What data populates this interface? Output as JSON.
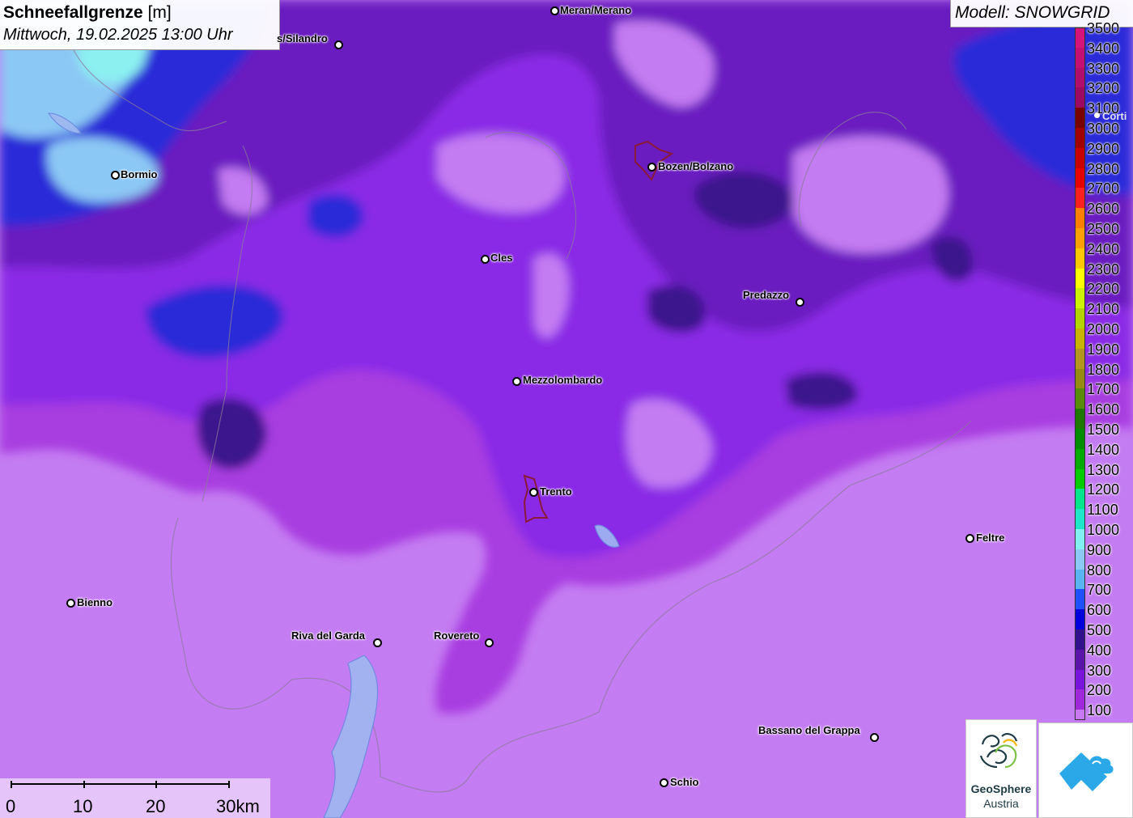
{
  "title": {
    "main": "Schneefallgrenze",
    "unit": "[m]",
    "datetime": "Mittwoch, 19.02.2025 13:00 Uhr"
  },
  "model": "Modell: SNOWGRID",
  "legend": {
    "items": [
      {
        "label": "3500",
        "color": "#d4147a"
      },
      {
        "label": "3400",
        "color": "#c41072"
      },
      {
        "label": "3300",
        "color": "#b10d6a"
      },
      {
        "label": "3200",
        "color": "#9c0a62"
      },
      {
        "label": "3100",
        "color": "#7a0000"
      },
      {
        "label": "3000",
        "color": "#a00000"
      },
      {
        "label": "2900",
        "color": "#c80000"
      },
      {
        "label": "2800",
        "color": "#e60000"
      },
      {
        "label": "2700",
        "color": "#ff2020"
      },
      {
        "label": "2600",
        "color": "#ff7f00"
      },
      {
        "label": "2500",
        "color": "#ffa000"
      },
      {
        "label": "2400",
        "color": "#ffc800"
      },
      {
        "label": "2300",
        "color": "#ffff00"
      },
      {
        "label": "2200",
        "color": "#ccf200"
      },
      {
        "label": "2100",
        "color": "#b4d400"
      },
      {
        "label": "2000",
        "color": "#c8b400"
      },
      {
        "label": "1900",
        "color": "#b4961e"
      },
      {
        "label": "1800",
        "color": "#968c14"
      },
      {
        "label": "1700",
        "color": "#5a8c0a"
      },
      {
        "label": "1600",
        "color": "#1e7800"
      },
      {
        "label": "1500",
        "color": "#008c00"
      },
      {
        "label": "1400",
        "color": "#00aa00"
      },
      {
        "label": "1300",
        "color": "#00cc00"
      },
      {
        "label": "1200",
        "color": "#00e68c"
      },
      {
        "label": "1100",
        "color": "#1ee6c8"
      },
      {
        "label": "1000",
        "color": "#82f0f0"
      },
      {
        "label": "900",
        "color": "#8cc8f5"
      },
      {
        "label": "800",
        "color": "#5ab4f0"
      },
      {
        "label": "700",
        "color": "#1e50ff"
      },
      {
        "label": "600",
        "color": "#0000dc"
      },
      {
        "label": "500",
        "color": "#32128c"
      },
      {
        "label": "400",
        "color": "#5a14a8"
      },
      {
        "label": "300",
        "color": "#7814dc"
      },
      {
        "label": "200",
        "color": "#a028dc"
      },
      {
        "label": "100",
        "color": "#c878f0"
      }
    ]
  },
  "cities": [
    {
      "name": "Meran/Merano"
    },
    {
      "name": "s/Silandro"
    },
    {
      "name": "Bormio"
    },
    {
      "name": "Bozen/Bolzano"
    },
    {
      "name": "Cles"
    },
    {
      "name": "Predazzo"
    },
    {
      "name": "Mezzolombardo"
    },
    {
      "name": "Trento"
    },
    {
      "name": "Feltre"
    },
    {
      "name": "Bienno"
    },
    {
      "name": "Riva del Garda"
    },
    {
      "name": "Rovereto"
    },
    {
      "name": "Bassano del Grappa"
    },
    {
      "name": "Schio"
    },
    {
      "name": "Corti"
    }
  ],
  "scale": {
    "labels": [
      "0",
      "10",
      "20",
      "30km"
    ]
  },
  "logos": {
    "geosphere_line1": "GeoSphere",
    "geosphere_line2": "Austria"
  }
}
